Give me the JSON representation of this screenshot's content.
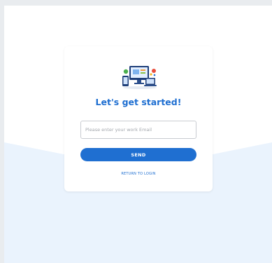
{
  "card": {
    "heading": "Let's get started!",
    "email_placeholder": "Please enter your work Email",
    "send_label": "SEND",
    "return_label": "RETURN TO LOGIN",
    "illustration_icon": "devices-illustration-icon"
  },
  "colors": {
    "primary": "#1f6fd1",
    "background_wave": "#eaf3fd",
    "card": "#ffffff"
  }
}
